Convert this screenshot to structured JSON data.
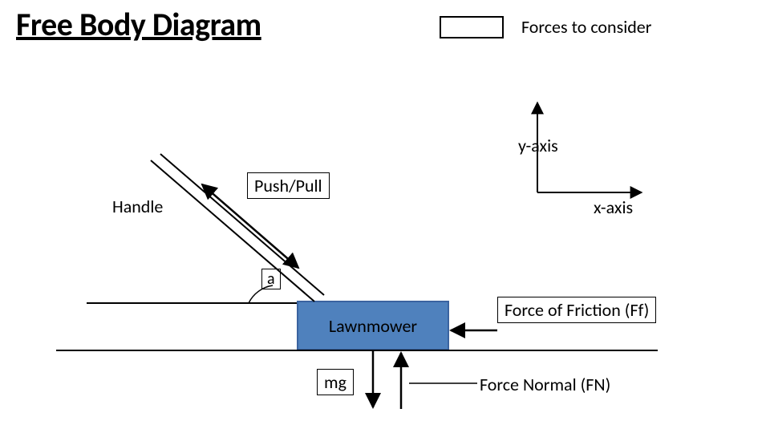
{
  "title": "Free Body Diagram",
  "legend": {
    "caption": "Forces to consider"
  },
  "axes": {
    "x": "x-axis",
    "y": "y-axis"
  },
  "labels": {
    "handle": "Handle",
    "push_pull": "Push/Pull",
    "angle": "a",
    "lawnmower": "Lawnmower",
    "mg": "mg",
    "friction": "Force of Friction (Ff)",
    "normal": "Force Normal (FN)"
  },
  "forces": [
    "Push/Pull",
    "Force of Friction (Ff)",
    "Force Normal (FN)",
    "mg"
  ],
  "object": "Lawnmower",
  "angle_symbol": "a",
  "colors": {
    "lawnmower_fill": "#4f81bd",
    "lawnmower_stroke": "#3a63a0"
  }
}
